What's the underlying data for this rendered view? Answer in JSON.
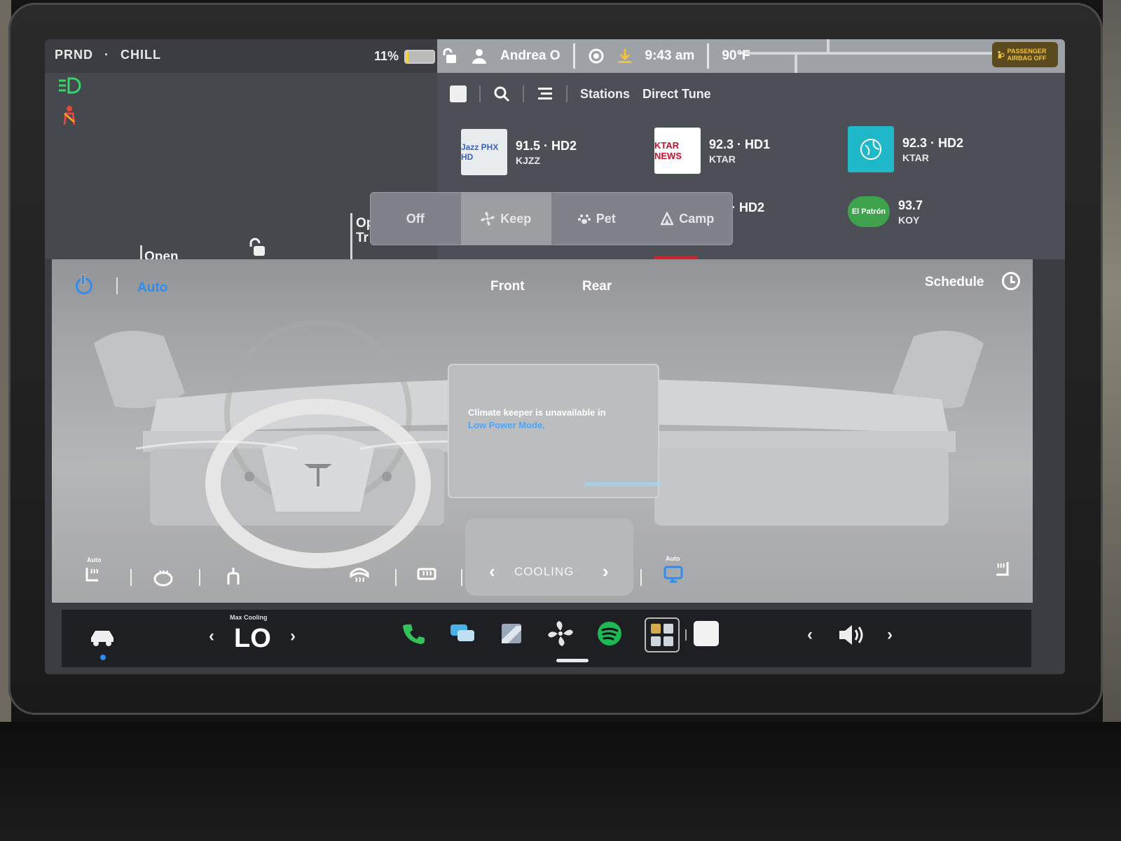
{
  "status": {
    "gear": "PRND",
    "dot": "·",
    "drive_mode": "CHILL",
    "battery_pct": "11%",
    "battery_level": 0.11,
    "user": "Andrea O",
    "time": "9:43 am",
    "temp_outside": "90°F",
    "passenger_airbag": "PASSENGER AIRBAG OFF"
  },
  "car_panel": {
    "open_frunk": "Open\nFrunk",
    "open_trunk": "Open\nTr"
  },
  "media": {
    "tabs": [
      "Stations",
      "Direct Tune"
    ],
    "stations": [
      {
        "freq": "91.5 · HD2",
        "call": "KJZZ",
        "logo_text": "Jazz PHX HD",
        "logo_bg": "#e9ecef"
      },
      {
        "freq": "92.3 · HD1",
        "call": "KTAR",
        "logo_text": "KTAR NEWS",
        "logo_bg": "#ffffff"
      },
      {
        "freq": "92.3 · HD2",
        "call": "KTAR",
        "logo_text": "",
        "logo_bg": "#1fb8c9"
      },
      {
        "freq": "· HD2",
        "call": "",
        "logo_text": "",
        "logo_bg": ""
      },
      {
        "freq": "93.7",
        "call": "KOY",
        "logo_text": "El Patrón",
        "logo_bg": "#3fa34d"
      }
    ]
  },
  "keep_modes": {
    "options": [
      "Off",
      "Keep",
      "Pet",
      "Camp"
    ],
    "selected": "Keep"
  },
  "climate": {
    "auto": "Auto",
    "tab_front": "Front",
    "tab_rear": "Rear",
    "schedule": "Schedule",
    "message_prefix": "Climate keeper is unavailable in ",
    "message_link": "Low Power Mode.",
    "mode": "COOLING",
    "seat_auto": "Auto",
    "recirc_auto": "Auto"
  },
  "dock": {
    "max_cooling": "Max Cooling",
    "temp": "LO"
  },
  "colors": {
    "accent": "#2f8cf0",
    "spotify": "#1db954",
    "phone": "#33c25a",
    "headlight": "#37d36b",
    "seatbelt": "#e8453c"
  }
}
